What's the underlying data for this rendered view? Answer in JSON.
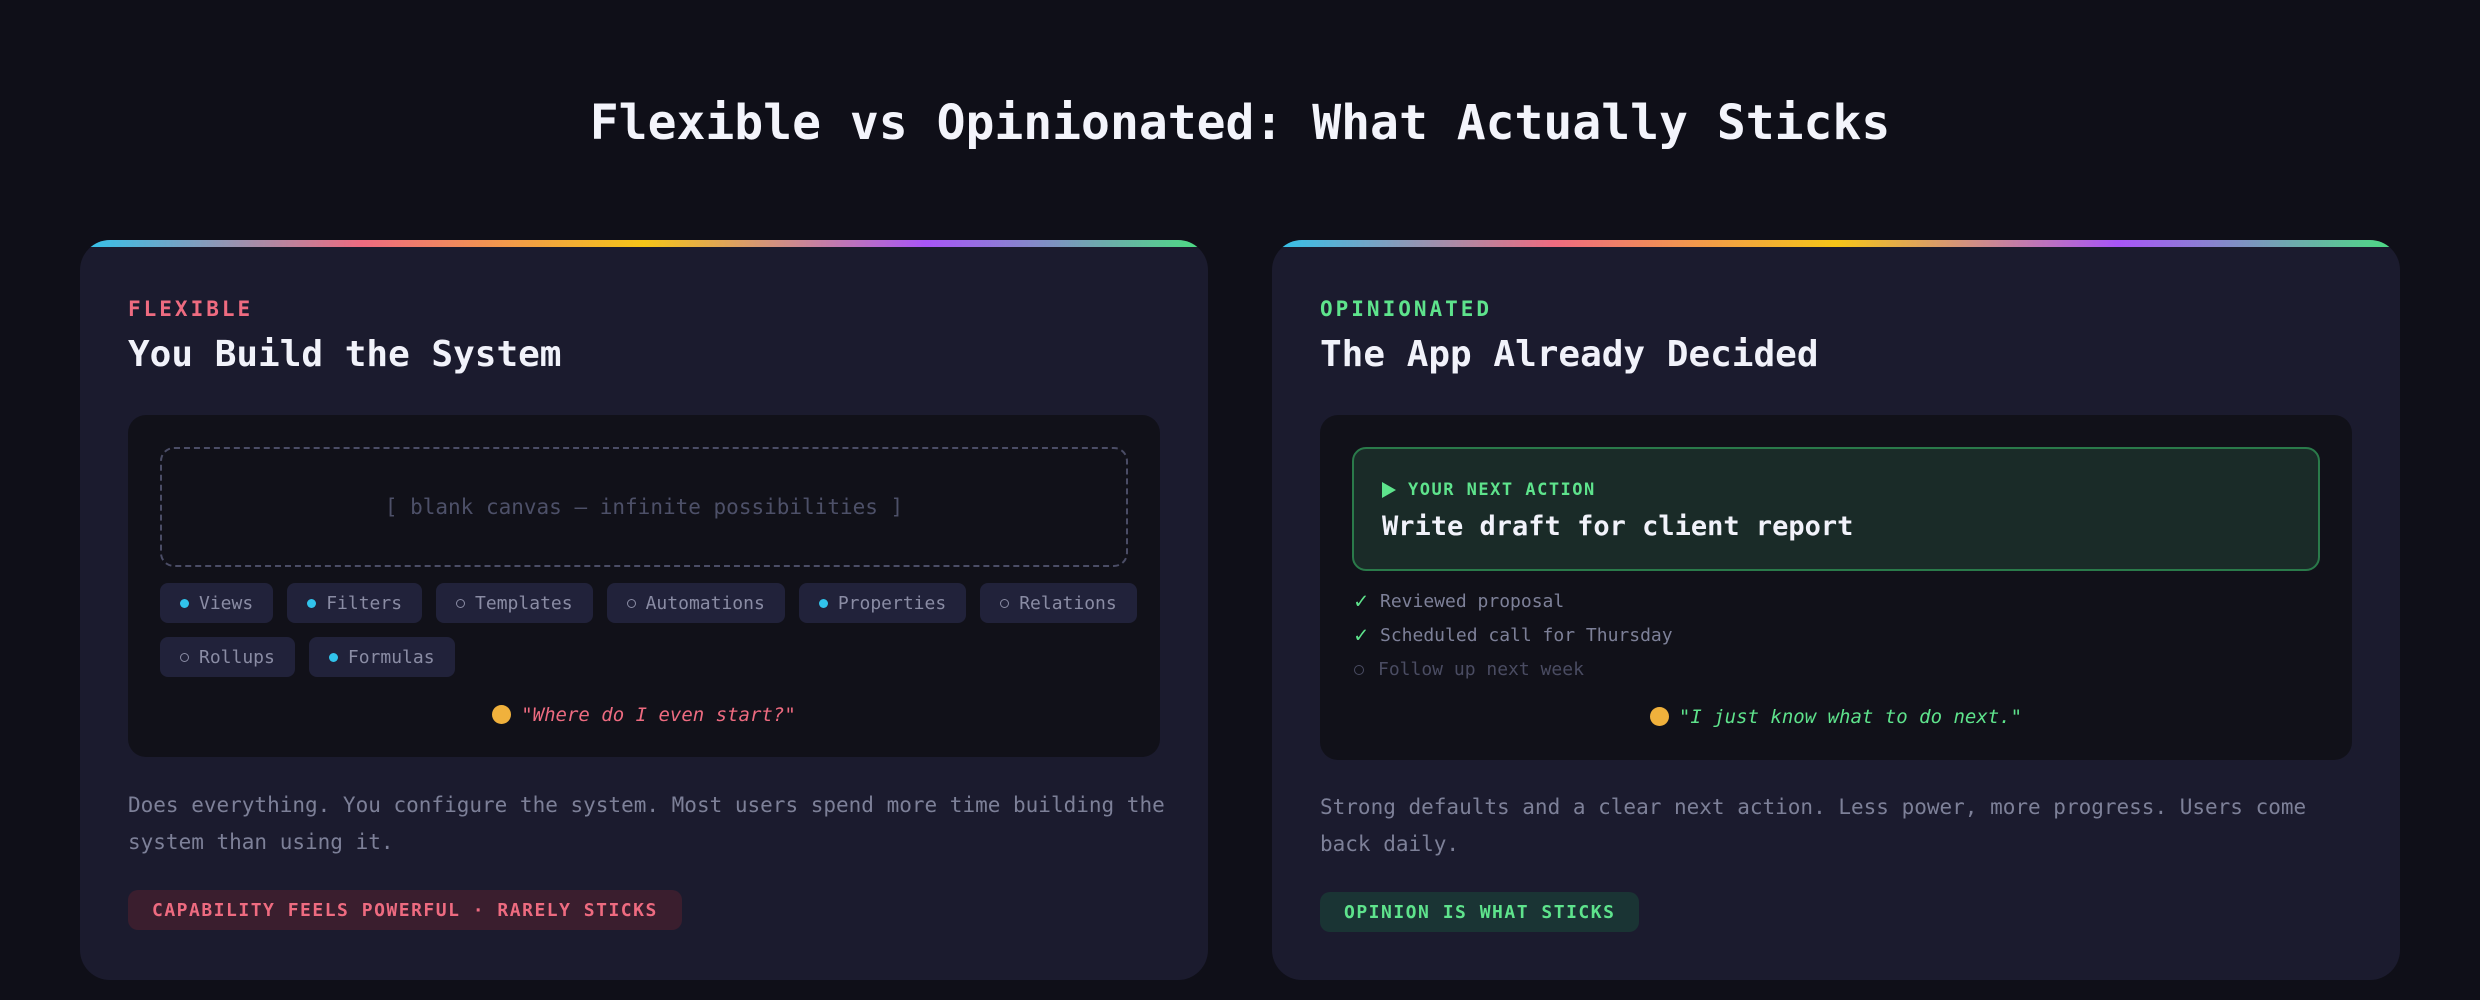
{
  "page": {
    "title": "Flexible vs Opinionated: What Actually Sticks"
  },
  "colors": {
    "background": "#0f0f18",
    "card": "#1b1b2e",
    "flexible_accent": "#ee6b80",
    "opinionated_accent": "#5ee38c",
    "chip_dot": "#31c3eb",
    "gradient_stops": [
      "#31c3eb",
      "#ee6b80",
      "#f5c518",
      "#a855f7",
      "#4ade80"
    ]
  },
  "flexible": {
    "eyebrow": "FLEXIBLE",
    "title": "You Build the System",
    "canvas_text": "[ blank canvas — infinite possibilities ]",
    "chips": [
      {
        "label": "Views",
        "active": true
      },
      {
        "label": "Filters",
        "active": true
      },
      {
        "label": "Templates",
        "active": false
      },
      {
        "label": "Automations",
        "active": false
      },
      {
        "label": "Properties",
        "active": true
      },
      {
        "label": "Relations",
        "active": false
      },
      {
        "label": "Rollups",
        "active": false
      },
      {
        "label": "Formulas",
        "active": true
      }
    ],
    "quote_icon": "dizzy-face-emoji",
    "quote": "\"Where do I even start?\"",
    "description": "Does everything. You configure the system. Most users spend more time building the system than using it.",
    "verdict": "CAPABILITY FEELS POWERFUL · RARELY STICKS"
  },
  "opinionated": {
    "eyebrow": "OPINIONATED",
    "title": "The App Already Decided",
    "next_action_label": "YOUR NEXT ACTION",
    "next_action": "Write draft for client report",
    "checklist": [
      {
        "label": "Reviewed proposal",
        "done": true
      },
      {
        "label": "Scheduled call for Thursday",
        "done": true
      },
      {
        "label": "Follow up next week",
        "done": false
      }
    ],
    "quote_icon": "relieved-face-emoji",
    "quote": "\"I just know what to do next.\"",
    "description": "Strong defaults and a clear next action. Less power, more progress. Users come back daily.",
    "verdict": "OPINION IS WHAT STICKS"
  }
}
